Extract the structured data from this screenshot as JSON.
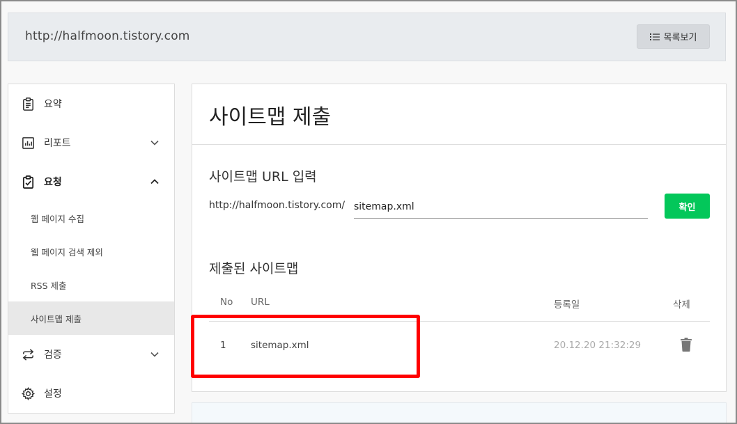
{
  "header": {
    "site_url": "http://halfmoon.tistory.com",
    "list_button_label": "목록보기",
    "list_icon": "list-icon"
  },
  "sidebar": {
    "items": [
      {
        "label": "요약",
        "icon": "clipboard-icon"
      },
      {
        "label": "리포트",
        "icon": "chart-icon",
        "chevron": "down"
      },
      {
        "label": "요청",
        "icon": "clipboard-check-icon",
        "chevron": "up"
      },
      {
        "label": "검증",
        "icon": "arrows-exchange-icon",
        "chevron": "down"
      },
      {
        "label": "설정",
        "icon": "gear-icon"
      }
    ],
    "sub_items": [
      {
        "label": "웹 페이지 수집"
      },
      {
        "label": "웹 페이지 검색 제외"
      },
      {
        "label": "RSS 제출"
      },
      {
        "label": "사이트맵 제출",
        "active": true
      }
    ]
  },
  "main": {
    "title": "사이트맵 제출",
    "input_section_title": "사이트맵 URL 입력",
    "url_prefix": "http://halfmoon.tistory.com/",
    "url_input_value": "sitemap.xml",
    "confirm_label": "확인",
    "submitted_section_title": "제출된 사이트맵",
    "table": {
      "columns": [
        "No",
        "URL",
        "등록일",
        "삭제"
      ],
      "rows": [
        {
          "no": "1",
          "url": "sitemap.xml",
          "date": "20.12.20 21:32:29",
          "delete_icon": "trash-icon"
        }
      ]
    }
  },
  "colors": {
    "accent_green": "#03c75a",
    "highlight_red": "#ff0000",
    "active_bg": "#e8e8e8"
  }
}
